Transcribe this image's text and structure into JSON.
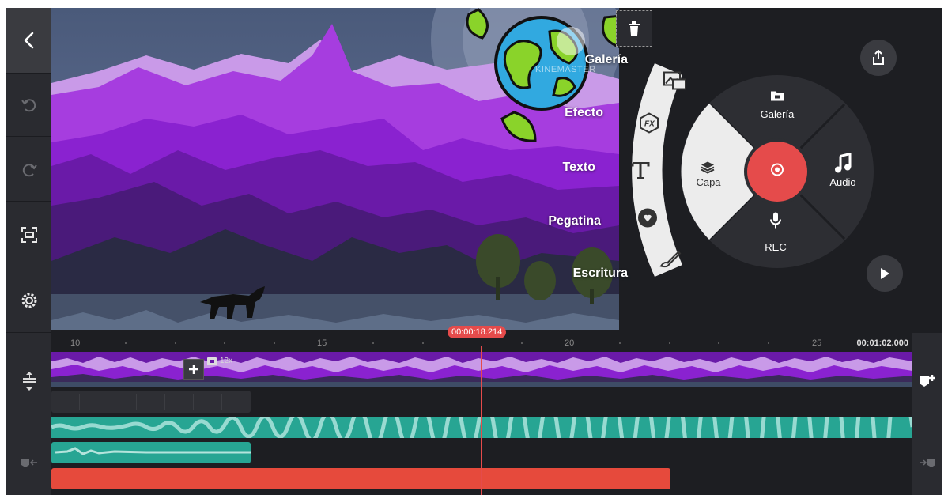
{
  "colors": {
    "accent_red": "#e54b4b",
    "audio_teal": "#27a593",
    "rec_red": "#e64a3c",
    "panel": "#2a2b30",
    "background": "#1d1e22"
  },
  "left_toolbar": {
    "back_icon": "chevron-left-icon",
    "undo_icon": "undo-icon",
    "redo_icon": "redo-icon",
    "crop_icon": "fullscreen-crop-icon",
    "settings_icon": "gear-icon"
  },
  "preview": {
    "watermark": "KINEMASTER"
  },
  "layer_menu": {
    "items": [
      {
        "label": "Galería",
        "icon": "image-icon"
      },
      {
        "label": "Efecto",
        "icon": "fx-icon"
      },
      {
        "label": "Texto",
        "icon": "text-icon"
      },
      {
        "label": "Pegatina",
        "icon": "sticker-icon"
      },
      {
        "label": "Escritura",
        "icon": "brush-icon"
      }
    ]
  },
  "wheel": {
    "top_label": "Galería",
    "left_label": "Capa",
    "right_label": "Audio",
    "bottom_label": "REC",
    "center_icon": "camera-shutter-icon"
  },
  "timeline": {
    "ticks": [
      "10",
      "15",
      "20",
      "25"
    ],
    "current_time": "00:00:18.214",
    "end_time": "00:01:02.000",
    "clip_info": "12x"
  }
}
